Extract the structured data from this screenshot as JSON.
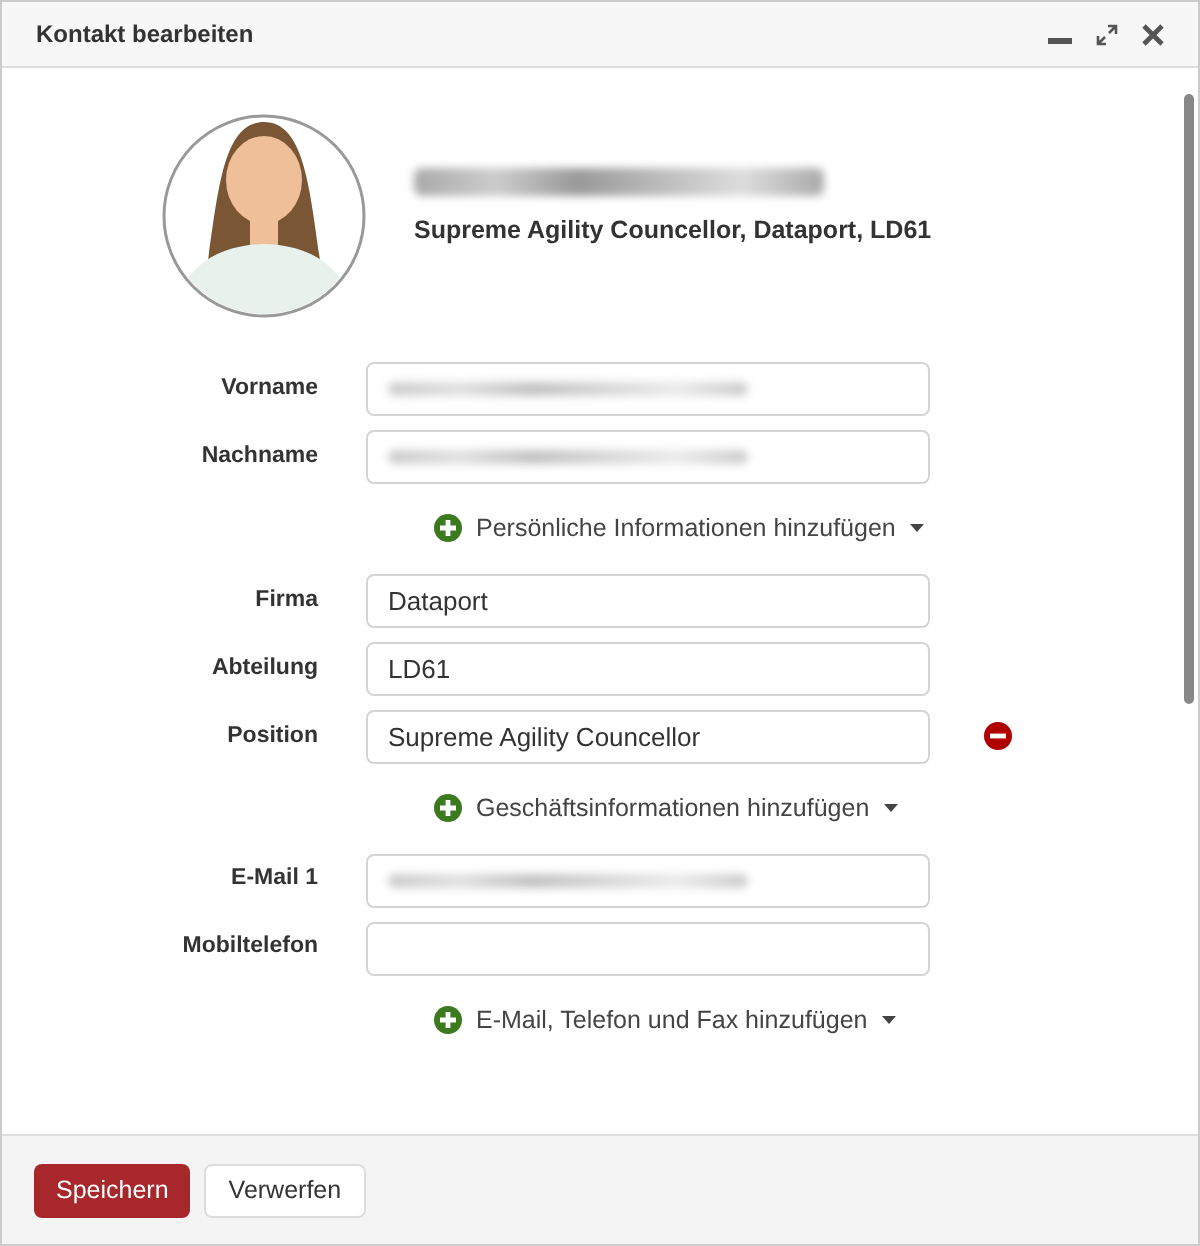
{
  "window": {
    "title": "Kontakt bearbeiten"
  },
  "header": {
    "name": {
      "kind": "blurred"
    },
    "subtitle": "Supreme Agility Councellor, Dataport, LD61"
  },
  "sections": [
    {
      "fields": [
        {
          "label": "Vorname",
          "kind": "blurred",
          "removable": false
        },
        {
          "label": "Nachname",
          "kind": "blurred",
          "removable": false
        }
      ],
      "add_link": "Persönliche Informationen hinzufügen"
    },
    {
      "fields": [
        {
          "label": "Firma",
          "kind": "text",
          "value": "Dataport",
          "removable": false
        },
        {
          "label": "Abteilung",
          "kind": "text",
          "value": "LD61",
          "removable": false
        },
        {
          "label": "Position",
          "kind": "text",
          "value": "Supreme Agility Councellor",
          "removable": true
        }
      ],
      "add_link": "Geschäftsinformationen hinzufügen"
    },
    {
      "fields": [
        {
          "label": "E-Mail 1",
          "kind": "blurred",
          "removable": false
        },
        {
          "label": "Mobiltelefon",
          "kind": "empty",
          "removable": false
        }
      ],
      "add_link": "E-Mail, Telefon und Fax hinzufügen"
    }
  ],
  "buttons": [
    {
      "label": "Speichern",
      "kind": "primary"
    },
    {
      "label": "Verwerfen",
      "kind": "secondary"
    }
  ]
}
